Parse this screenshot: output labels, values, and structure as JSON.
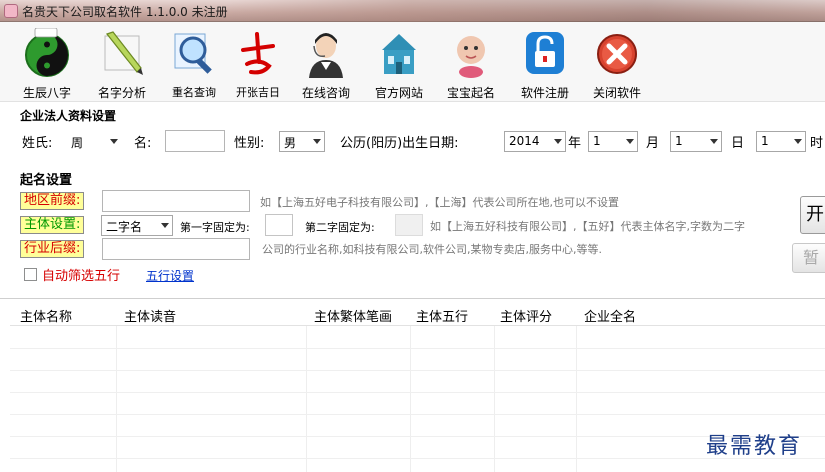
{
  "window": {
    "title": "名贵天下公司取名软件 1.1.0.0 未注册"
  },
  "toolbar": {
    "items": [
      {
        "label": "生辰八字",
        "icon": "bagua-icon"
      },
      {
        "label": "名字分析",
        "icon": "pen-icon"
      },
      {
        "label": "重名查询",
        "icon": "magnifier-icon"
      },
      {
        "label": "开张吉日",
        "icon": "calendar-char-icon"
      },
      {
        "label": "在线咨询",
        "icon": "support-agent-icon"
      },
      {
        "label": "官方网站",
        "icon": "building-icon"
      },
      {
        "label": "宝宝起名",
        "icon": "baby-icon"
      },
      {
        "label": "软件注册",
        "icon": "lock-icon"
      },
      {
        "label": "关闭软件",
        "icon": "close-circle-icon"
      }
    ]
  },
  "legal": {
    "section_title": "企业法人资料设置",
    "surname_label": "姓氏:",
    "surname_value": "周",
    "name_label": "名:",
    "name_value": "",
    "gender_label": "性别:",
    "gender_value": "男",
    "birth_label": "公历(阳历)出生日期:",
    "year_value": "2014",
    "year_unit": "年",
    "month_value": "1",
    "month_unit": "月",
    "day_value": "1",
    "day_unit": "日",
    "hour_value": "1",
    "hour_unit": "时"
  },
  "naming": {
    "section_title": "起名设置",
    "region_label": "地区前缀:",
    "region_value": "",
    "region_hint": "如【上海五好电子科技有限公司】,【上海】代表公司所在地,也可以不设置",
    "subject_label": "主体设置:",
    "subject_value": "二字名",
    "first_fixed_label": "第一字固定为:",
    "second_fixed_label": "第二字固定为:",
    "subject_hint": "如【上海五好科技有限公司】,【五好】代表主体名字,字数为二字",
    "industry_label": "行业后缀:",
    "industry_value": "",
    "industry_hint": "公司的行业名称,如科技有限公司,软件公司,某物专卖店,服务中心,等等.",
    "auto_filter_label": "自动筛选五行",
    "wuxing_settings_link": "五行设置",
    "start_button": "开",
    "pause_button": "暂"
  },
  "results": {
    "columns": [
      "主体名称",
      "主体读音",
      "主体繁体笔画",
      "主体五行",
      "主体评分",
      "企业全名"
    ],
    "rows": []
  },
  "watermark": "最需教育"
}
